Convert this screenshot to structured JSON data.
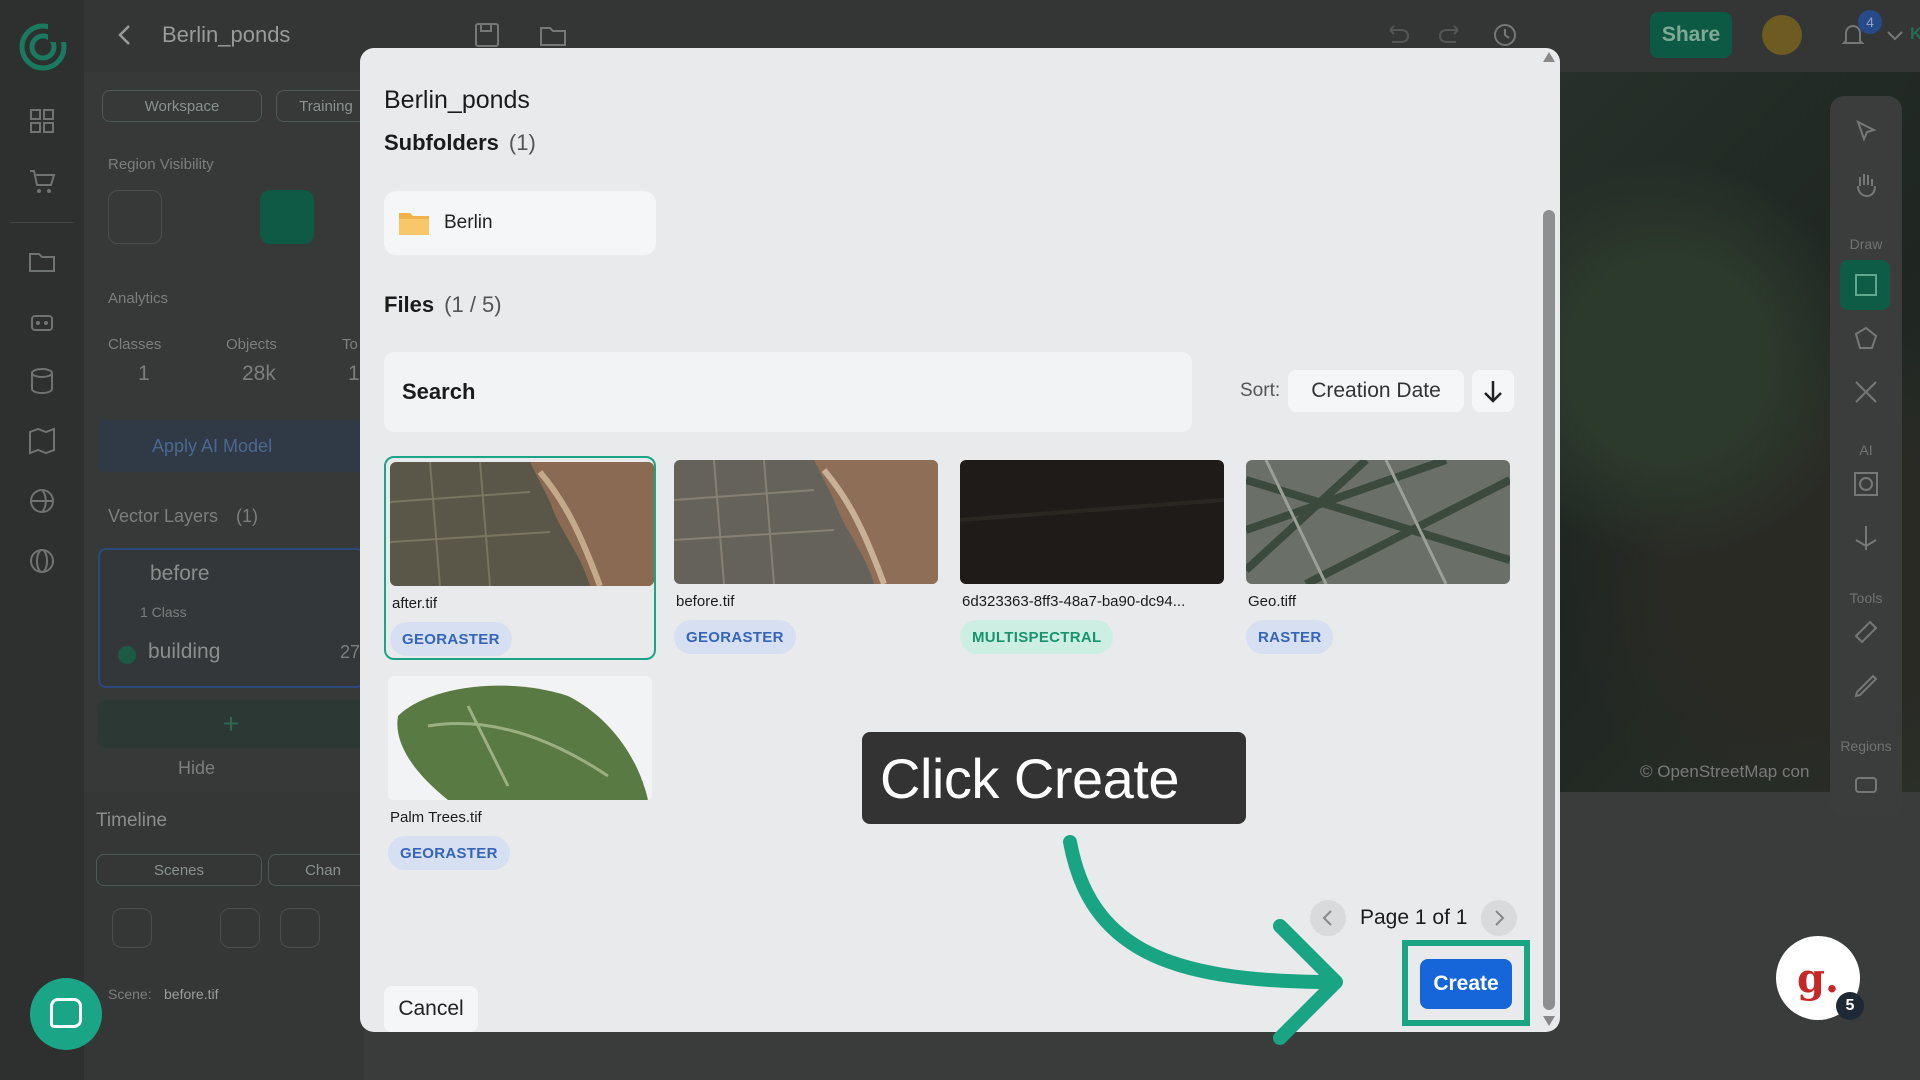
{
  "app": {
    "project_title": "Berlin_ponds",
    "share_label": "Share",
    "notification_count": "4",
    "user_initials": "KG"
  },
  "left_panel": {
    "tabs": [
      "Workspace",
      "Training"
    ],
    "region_visibility_label": "Region Visibility",
    "analytics_label": "Analytics",
    "stats": [
      {
        "label": "Classes",
        "value": "1"
      },
      {
        "label": "Objects",
        "value": "28k"
      },
      {
        "label": "To",
        "value": "1"
      }
    ],
    "apply_ai_label": "Apply AI Model",
    "vector_layers_label": "Vector Layers",
    "vector_layers_count": "(1)",
    "layer_name": "before",
    "layer_classes": "1 Class",
    "class_name": "building",
    "class_count": "27",
    "hide_label": "Hide",
    "timeline_label": "Timeline",
    "timeline_tabs": [
      "Scenes",
      "Chan"
    ],
    "scene_label": "Scene:",
    "scene_value": "before.tif"
  },
  "map": {
    "attribution": "© OpenStreetMap con",
    "tool_sections": [
      "Draw",
      "AI",
      "Tools",
      "Regions"
    ]
  },
  "modal": {
    "folder_title": "Berlin_ponds",
    "subfolders_label": "Subfolders",
    "subfolders_count": "(1)",
    "subfolder_name": "Berlin",
    "files_label": "Files",
    "files_count": "(1 / 5)",
    "search_placeholder": "Search",
    "sort_label": "Sort:",
    "sort_value": "Creation Date",
    "files": [
      {
        "name": "after.tif",
        "tag": "GEORASTER",
        "selected": true
      },
      {
        "name": "before.tif",
        "tag": "GEORASTER",
        "selected": false
      },
      {
        "name": "6d323363-8ff3-48a7-ba90-dc94...",
        "tag": "MULTISPECTRAL",
        "selected": false
      },
      {
        "name": "Geo.tiff",
        "tag": "RASTER",
        "selected": false
      },
      {
        "name": "Palm Trees.tif",
        "tag": "GEORASTER",
        "selected": false
      }
    ],
    "pagination": "Page 1 of 1",
    "cancel_label": "Cancel",
    "create_label": "Create"
  },
  "tutorial": {
    "tooltip_text": "Click Create",
    "guide_badge_count": "5"
  },
  "colors": {
    "accent_green": "#19a584",
    "primary_blue": "#1766d9",
    "modal_bg": "#e8eaec"
  }
}
